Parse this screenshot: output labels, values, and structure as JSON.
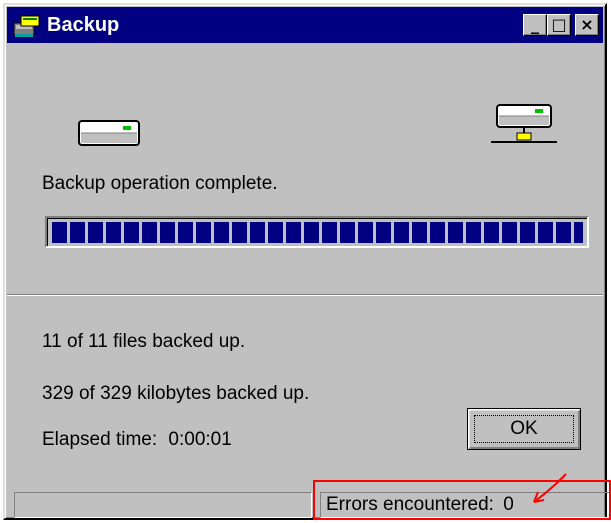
{
  "window": {
    "title": "Backup",
    "icon": "backup-app-icon",
    "controls": {
      "minimize_icon": "minimize-icon",
      "maximize_icon": "maximize-icon",
      "close_icon": "close-icon",
      "minimize_glyph": "_",
      "maximize_glyph": "□",
      "close_glyph": "×"
    }
  },
  "icons": {
    "source": "disk-drive-icon",
    "destination": "network-drive-icon"
  },
  "status": {
    "message": "Backup operation complete."
  },
  "progress": {
    "percent": 100
  },
  "summary": {
    "files": "11 of 11 files backed up.",
    "kilobytes": "329 of 329 kilobytes backed up.",
    "elapsed_label": "Elapsed time:",
    "elapsed_value": "0:00:01"
  },
  "buttons": {
    "ok_label": "OK"
  },
  "statusbar": {
    "left_text": "",
    "errors_label": "Errors encountered:",
    "errors_value": "0"
  },
  "colors": {
    "titlebar": "#000080",
    "window_face": "#c0c0c0",
    "progress_fill": "#000080",
    "annotation": "#ff0000"
  }
}
